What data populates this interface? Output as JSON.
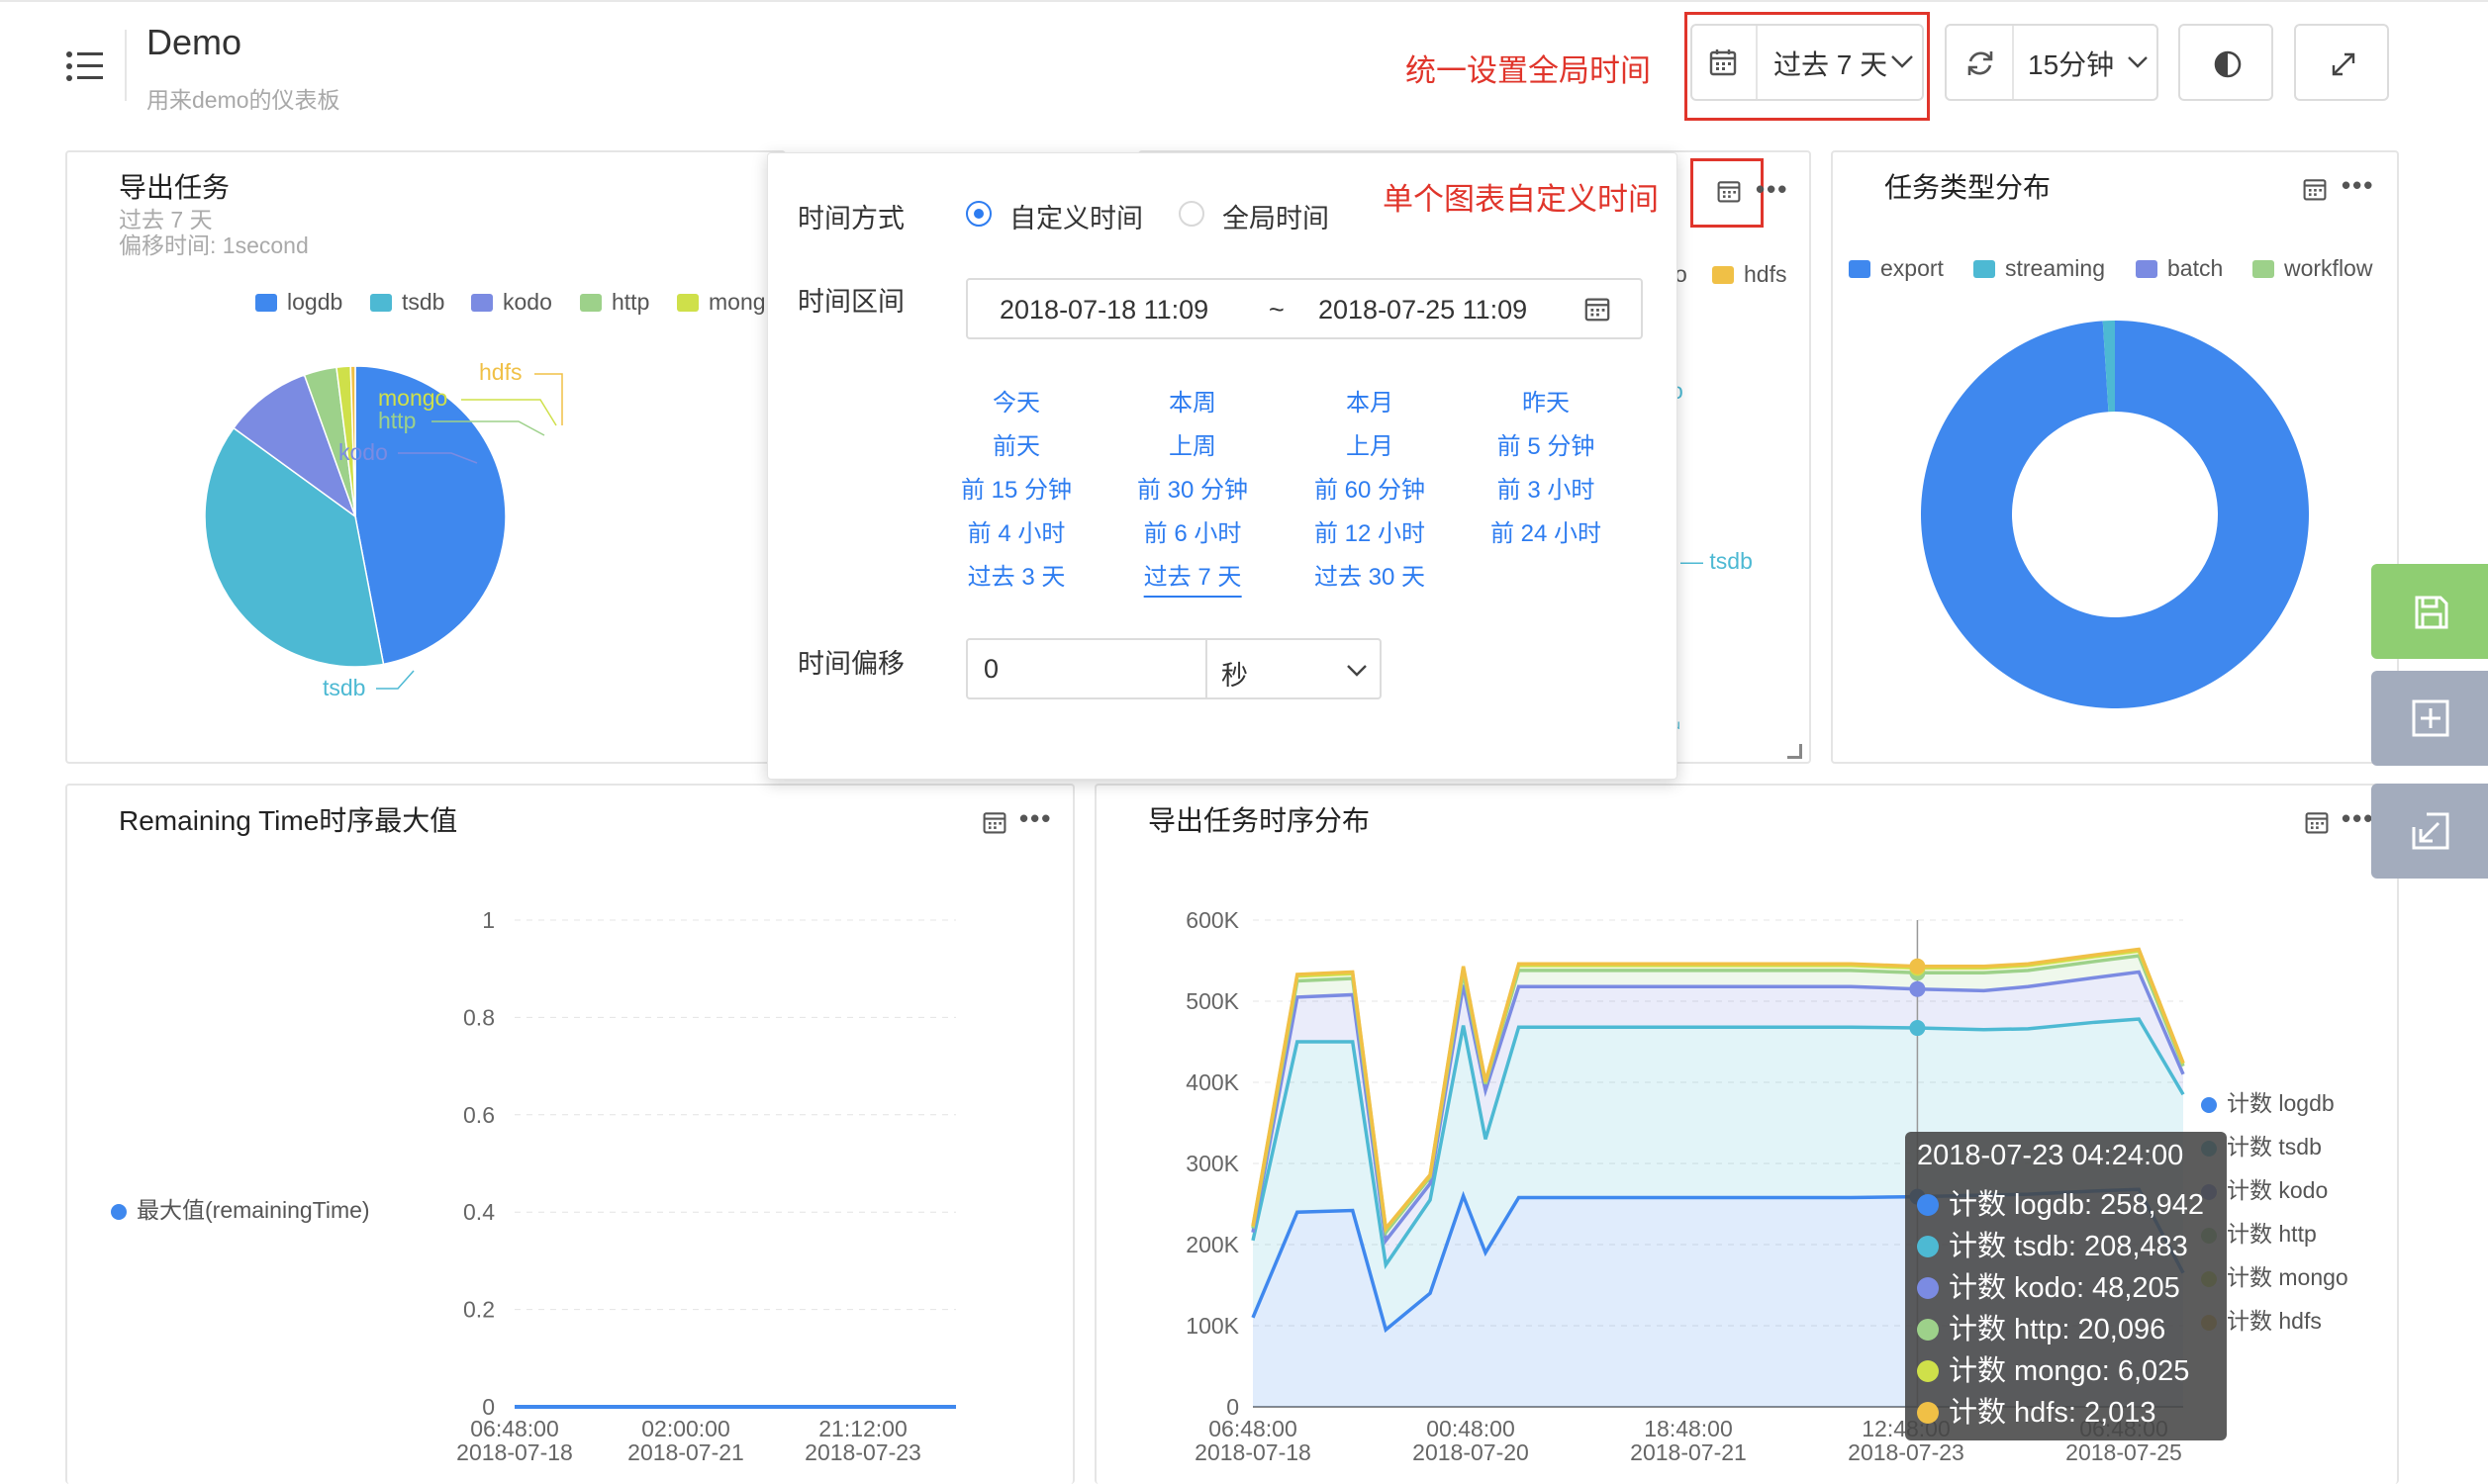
{
  "header": {
    "title": "Demo",
    "subtitle": "用来demo的仪表板",
    "global_time_note": "统一设置全局时间",
    "time_range": "过去 7 天",
    "refresh_interval": "15分钟"
  },
  "panels": {
    "export_tasks": {
      "title": "导出任务",
      "time": "过去 7 天",
      "offset": "偏移时间: 1second",
      "legend": [
        "logdb",
        "tsdb",
        "kodo",
        "http",
        "mong"
      ],
      "slice_labels": [
        "hdfs",
        "mongo",
        "http",
        "kodo",
        "tsdb"
      ]
    },
    "middle_hidden": {
      "legend_fragments": [
        "o",
        "hdfs"
      ],
      "labels": [
        "o",
        "tsdb",
        "u"
      ]
    },
    "task_types": {
      "title": "任务类型分布",
      "legend": [
        "export",
        "streaming",
        "batch",
        "workflow"
      ]
    },
    "remaining_time": {
      "title": "Remaining Time时序最大值",
      "legend": "最大值(remainingTime)"
    },
    "export_timeseries": {
      "title": "导出任务时序分布",
      "legend": [
        "计数 logdb",
        "计数 tsdb",
        "计数 kodo",
        "计数 http",
        "计数 mongo",
        "计数 hdfs"
      ]
    }
  },
  "popup": {
    "custom_note": "单个图表自定义时间",
    "mode_label": "时间方式",
    "mode_custom": "自定义时间",
    "mode_global": "全局时间",
    "range_label": "时间区间",
    "range_start": "2018-07-18 11:09",
    "range_sep": "~",
    "range_end": "2018-07-25 11:09",
    "quick_ranges": [
      [
        "今天",
        "本周",
        "本月",
        "昨天"
      ],
      [
        "前天",
        "上周",
        "上月",
        "前 5 分钟"
      ],
      [
        "前 15 分钟",
        "前 30 分钟",
        "前 60 分钟",
        "前 3 小时"
      ],
      [
        "前 4 小时",
        "前 6 小时",
        "前 12 小时",
        "前 24 小时"
      ],
      [
        "过去 3 天",
        "过去 7 天",
        "过去 30 天"
      ]
    ],
    "offset_label": "时间偏移",
    "offset_value": "0",
    "offset_unit": "秒"
  },
  "tooltip": {
    "title": "2018-07-23 04:24:00",
    "rows": [
      "计数 logdb: 258,942",
      "计数 tsdb: 208,483",
      "计数 kodo: 48,205",
      "计数 http: 20,096",
      "计数 mongo: 6,025",
      "计数 hdfs: 2,013"
    ]
  },
  "colors": {
    "logdb": "#3f88ee",
    "tsdb": "#4db9d3",
    "kodo": "#7b8be2",
    "http": "#9dd18a",
    "mongo": "#cfe04a",
    "hdfs": "#f0c046",
    "accent": "#2d7cf0",
    "note_red": "#e0352b",
    "save_green": "#8fce72",
    "side_gray": "#a3acbd"
  },
  "icons": [
    "menu-icon",
    "calendar-icon",
    "chevron-down-icon",
    "refresh-icon",
    "contrast-icon",
    "fullscreen-icon",
    "more-icon",
    "save-icon",
    "add-icon",
    "import-icon"
  ],
  "chart_data": [
    {
      "type": "pie",
      "title": "导出任务",
      "categories": [
        "logdb",
        "tsdb",
        "kodo",
        "http",
        "mongo",
        "hdfs"
      ],
      "values": [
        47,
        38,
        9.5,
        3.5,
        1.5,
        0.5
      ]
    },
    {
      "type": "pie",
      "title": "任务类型分布",
      "categories": [
        "export",
        "streaming",
        "batch",
        "workflow"
      ],
      "values": [
        99,
        1,
        0,
        0
      ]
    },
    {
      "type": "line",
      "title": "Remaining Time时序最大值",
      "x_ticks": [
        [
          "06:48:00",
          "2018-07-18"
        ],
        [
          "02:00:00",
          "2018-07-21"
        ],
        [
          "21:12:00",
          "2018-07-23"
        ]
      ],
      "y_ticks": [
        "0",
        "0.2",
        "0.4",
        "0.6",
        "0.8",
        "1"
      ],
      "ylim": [
        0,
        1
      ],
      "series": [
        {
          "name": "最大值(remainingTime)",
          "values": [
            0,
            0,
            0,
            0,
            0
          ]
        }
      ]
    },
    {
      "type": "area",
      "title": "导出任务时序分布",
      "x_ticks": [
        [
          "06:48:00",
          "2018-07-18"
        ],
        [
          "00:48:00",
          "2018-07-20"
        ],
        [
          "18:48:00",
          "2018-07-21"
        ],
        [
          "12:48:00",
          "2018-07-23"
        ],
        [
          "06:48:00",
          "2018-07-25"
        ]
      ],
      "y_ticks": [
        "0",
        "100K",
        "200K",
        "300K",
        "400K",
        "500K",
        "600K"
      ],
      "ylim": [
        0,
        600000
      ],
      "x": [
        0,
        0.2,
        0.45,
        0.6,
        0.8,
        0.95,
        1.05,
        1.2,
        1.4,
        1.5,
        1.7,
        2.0,
        2.2,
        2.5,
        2.7,
        3.0,
        3.3,
        3.5,
        3.8,
        4.0,
        4.2
      ],
      "series": [
        {
          "name": "计数 logdb",
          "values": [
            110000,
            240000,
            242000,
            95000,
            140000,
            260000,
            190000,
            258000,
            258000,
            258000,
            258000,
            258000,
            258000,
            258000,
            258000,
            259000,
            261000,
            262000,
            266000,
            268000,
            165000
          ]
        },
        {
          "name": "计数 tsdb",
          "values": [
            95000,
            210000,
            208000,
            80000,
            115000,
            210000,
            140000,
            210000,
            210000,
            210000,
            210000,
            210000,
            210000,
            210000,
            210000,
            208000,
            204000,
            204000,
            208000,
            210000,
            220000
          ]
        },
        {
          "name": "计数 kodo",
          "values": [
            10000,
            55000,
            58000,
            30000,
            20000,
            50000,
            60000,
            50000,
            50000,
            50000,
            50000,
            50000,
            50000,
            50000,
            50000,
            48000,
            48000,
            52000,
            55000,
            58000,
            25000
          ]
        },
        {
          "name": "计数 http",
          "values": [
            5000,
            20000,
            20000,
            10000,
            8000,
            15000,
            8000,
            20000,
            20000,
            20000,
            20000,
            20000,
            20000,
            20000,
            20000,
            20000,
            22000,
            20000,
            20000,
            20000,
            10000
          ]
        },
        {
          "name": "计数 mongo",
          "values": [
            2000,
            6000,
            6000,
            4000,
            2000,
            6000,
            2000,
            6000,
            6000,
            6000,
            6000,
            6000,
            6000,
            6000,
            6000,
            6000,
            6000,
            6000,
            6000,
            6000,
            3000
          ]
        },
        {
          "name": "计数 hdfs",
          "values": [
            1000,
            2000,
            2000,
            1000,
            1000,
            2000,
            1000,
            2000,
            2000,
            2000,
            2000,
            2000,
            2000,
            2000,
            2000,
            2000,
            2000,
            2000,
            2000,
            2000,
            1000
          ]
        }
      ]
    }
  ]
}
